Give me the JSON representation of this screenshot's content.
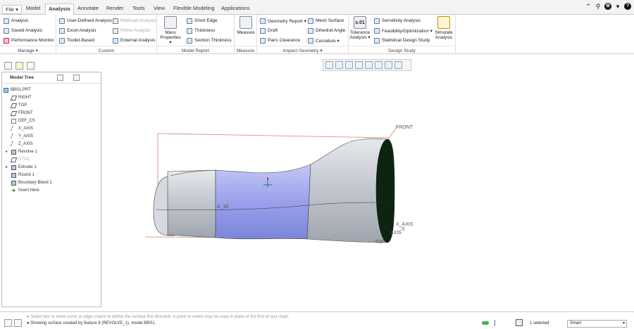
{
  "menubar": {
    "file": "File ▾",
    "tabs": [
      "Model",
      "Analysis",
      "Annotate",
      "Render",
      "Tools",
      "View",
      "Flexible Modeling",
      "Applications"
    ],
    "active": "Analysis",
    "topright_icons": [
      "chevron-up-icon",
      "search-icon",
      "gear-icon",
      "chevron-down-icon",
      "help-icon"
    ],
    "help_glyph": "?",
    "chevron_up": "⌃",
    "search_glyph": "⚲",
    "gear_glyph": "⚙",
    "chevron_down": "▾"
  },
  "ribbon": {
    "manage": {
      "label": "Manage ▾",
      "items": [
        "Analysis",
        "Saved Analysis",
        "Performance Monitor"
      ]
    },
    "custom": {
      "label": "Custom",
      "col1": [
        "User-Defined Analysis",
        "Excel Analysis",
        "Toolkit-Based"
      ],
      "col2": [
        "Mathcad Analysis",
        "Prime Analysis",
        "External Analysis"
      ]
    },
    "model_report": {
      "label": "Model Report",
      "big": "Mass Properties ▾",
      "items": [
        "Short Edge",
        "Thickness",
        "Section Thickness"
      ]
    },
    "measure": {
      "label": "Measure",
      "big": "Measure"
    },
    "inspect": {
      "label": "Inspect Geometry ▾",
      "col1": [
        "Geometry Report ▾",
        "Draft",
        "Pairs Clearance"
      ],
      "col2": [
        "Mesh Surface",
        "Dihedral Angle",
        "Curvature ▾"
      ]
    },
    "design_study": {
      "label": "Design Study",
      "tol_big": "Tolerance Analysis ▾",
      "tol_glyph": "±.01",
      "items": [
        "Sensitivity Analysis",
        "Feasibility/Optimization ▾",
        "Statistical Design Study"
      ],
      "sim_big": "Simulate Analysis"
    }
  },
  "model_tree": {
    "title": "Model Tree",
    "items": [
      {
        "label": "BBS1.PRT",
        "icon": "part-icon"
      },
      {
        "label": "RIGHT",
        "icon": "datum-plane-icon"
      },
      {
        "label": "TOP",
        "icon": "datum-plane-icon"
      },
      {
        "label": "FRONT",
        "icon": "datum-plane-icon"
      },
      {
        "label": "DEF_CS",
        "icon": "coord-system-icon"
      },
      {
        "label": "X_AXIS",
        "icon": "datum-axis-icon"
      },
      {
        "label": "Y_AXIS",
        "icon": "datum-axis-icon"
      },
      {
        "label": "Z_AXIS",
        "icon": "datum-axis-icon"
      },
      {
        "label": "Revolve 1",
        "icon": "revolve-icon"
      },
      {
        "label": "DTM1",
        "icon": "datum-plane-icon"
      },
      {
        "label": "Extrude 1",
        "icon": "extrude-icon"
      },
      {
        "label": "Round 1",
        "icon": "round-icon"
      },
      {
        "label": "Boundary Blend 1",
        "icon": "boundary-blend-icon"
      },
      {
        "label": "Insert Here",
        "icon": "insert-here-icon"
      }
    ]
  },
  "viewport": {
    "labels": {
      "front": "FRONT",
      "x_axis": "X_AXIS",
      "axis_s": "S",
      "axis_axis": "AXIS",
      "a30": "A_30",
      "top": "TOP"
    }
  },
  "status": {
    "line1": "● Select two or more curve or edge chains to define the surface first direction. A point or vertex may be used in place of the first or last chain.",
    "line2": "● Showing surface created by feature 8 (REVOLVE_1), model BBS1.",
    "selected": "1 selected",
    "filter": "Smart"
  },
  "colors": {
    "surface": "#c9cdd5",
    "blend": "#9ea6ee",
    "accent": "#2b57a6",
    "dark_face": "#0d2410"
  }
}
